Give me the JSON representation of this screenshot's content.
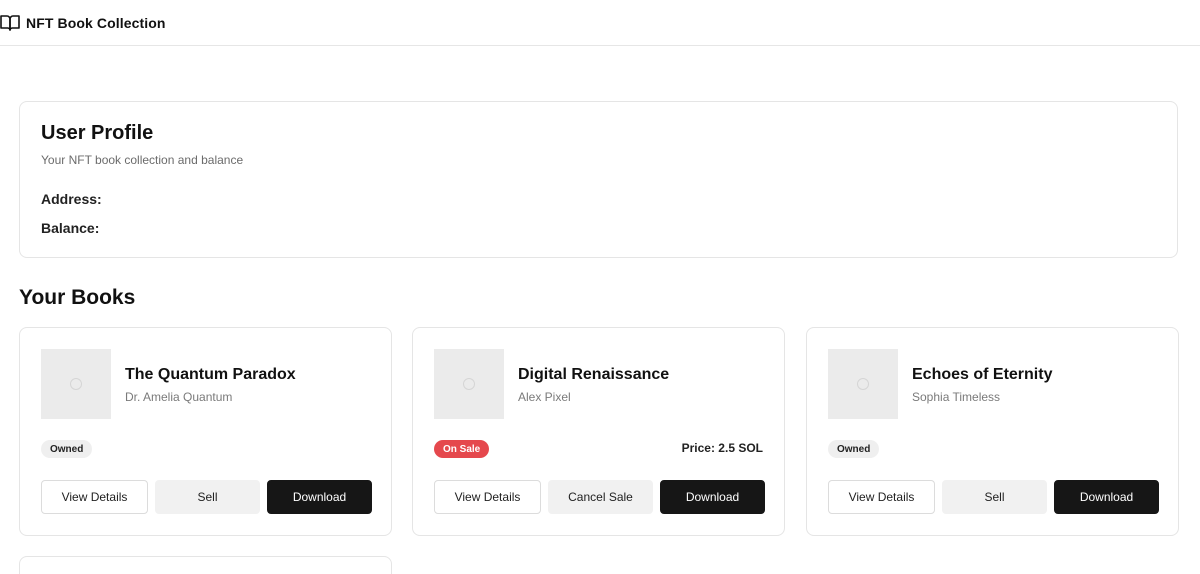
{
  "header": {
    "title": "NFT Book Collection",
    "icon": "open-book-icon"
  },
  "profile": {
    "title": "User Profile",
    "subtitle": "Your NFT book collection and balance",
    "address_label": "Address:",
    "address_value": "",
    "balance_label": "Balance:",
    "balance_value": ""
  },
  "books_section": {
    "title": "Your Books"
  },
  "books": [
    {
      "title": "The Quantum Paradox",
      "author": "Dr. Amelia Quantum",
      "status": "Owned",
      "price": "",
      "buttons": {
        "details": "View Details",
        "action": "Sell",
        "download": "Download"
      }
    },
    {
      "title": "Digital Renaissance",
      "author": "Alex Pixel",
      "status": "On Sale",
      "price": "Price: 2.5 SOL",
      "buttons": {
        "details": "View Details",
        "action": "Cancel Sale",
        "download": "Download"
      }
    },
    {
      "title": "Echoes of Eternity",
      "author": "Sophia Timeless",
      "status": "Owned",
      "price": "",
      "buttons": {
        "details": "View Details",
        "action": "Sell",
        "download": "Download"
      }
    }
  ],
  "colors": {
    "sale_badge": "#e5484d",
    "primary_button": "#161616",
    "owned_badge": "#efefef"
  }
}
